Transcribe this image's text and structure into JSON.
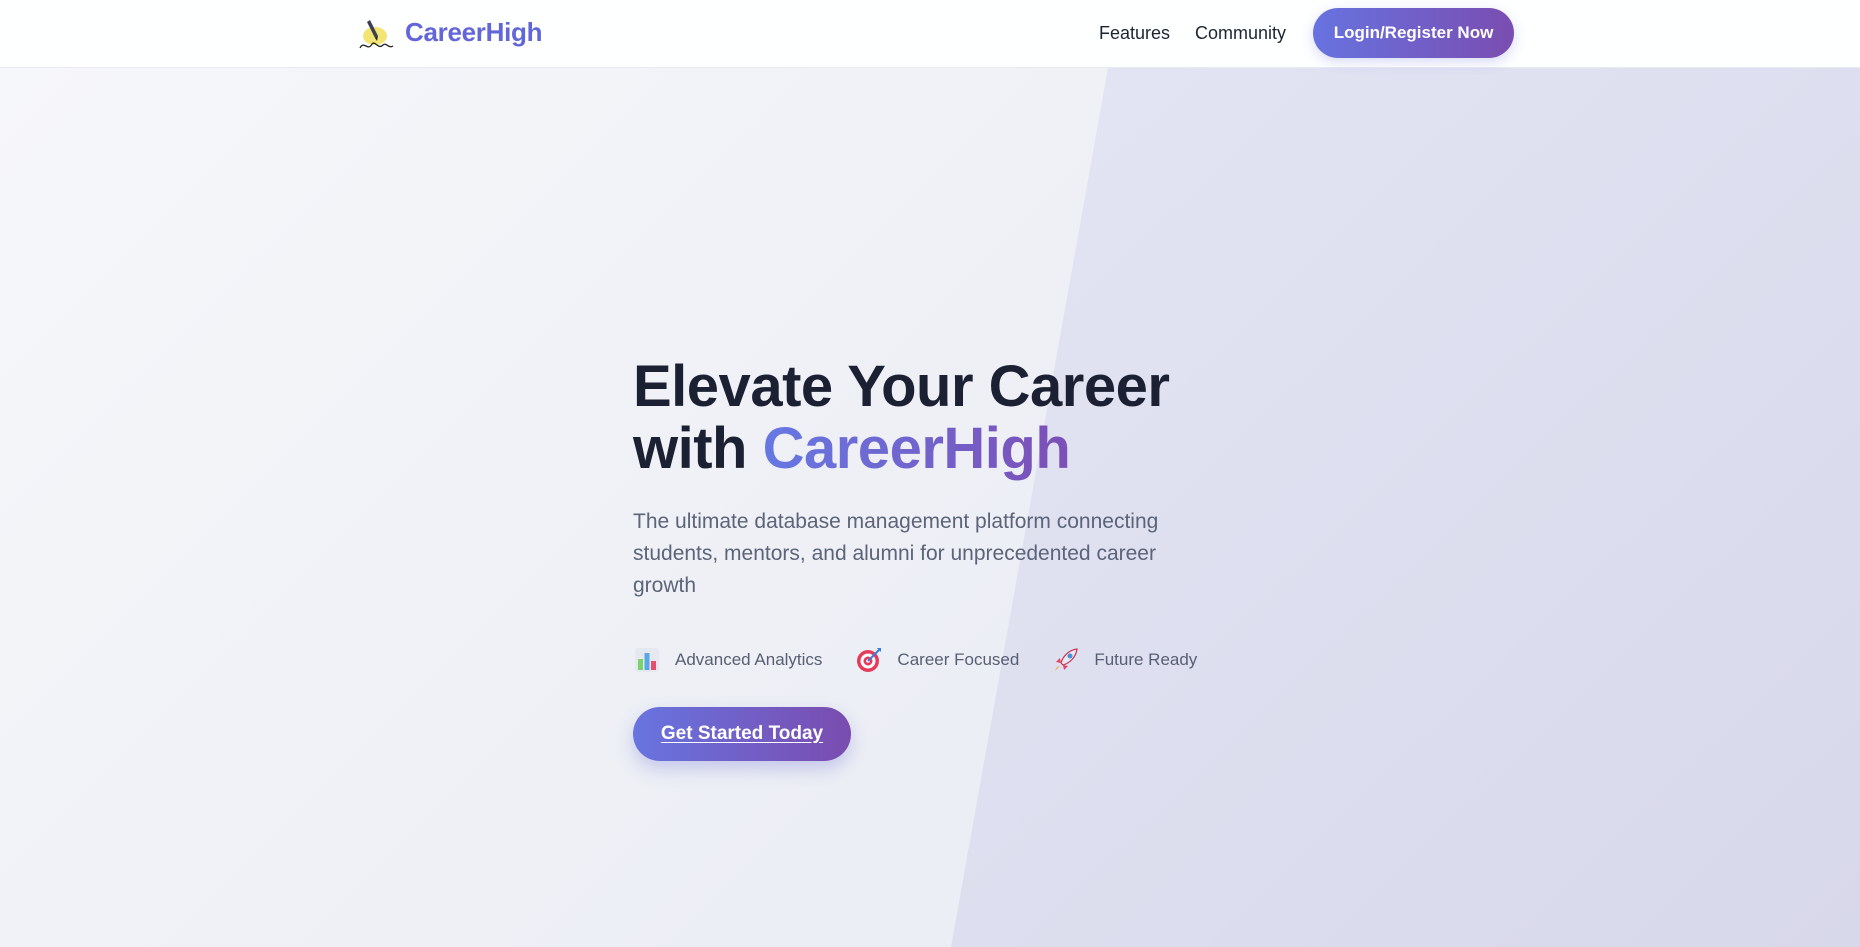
{
  "header": {
    "brand": "CareerHigh",
    "logo_icon": "pen-signature-logo-icon",
    "nav": [
      "Features",
      "Community"
    ],
    "login_label": "Login/Register Now"
  },
  "hero": {
    "headline_line1": "Elevate Your Career",
    "headline_with": "with ",
    "headline_accent": "CareerHigh",
    "subtitle": "The ultimate database management platform connecting students, mentors, and alumni for unprecedented career growth",
    "features": [
      {
        "icon": "bar-chart-icon",
        "label": "Advanced Analytics"
      },
      {
        "icon": "target-icon",
        "label": "Career Focused"
      },
      {
        "icon": "rocket-icon",
        "label": "Future Ready"
      }
    ],
    "cta_label": "Get Started Today"
  },
  "colors": {
    "brand": "#6366d9",
    "gradient_start": "#6678e3",
    "gradient_end": "#7a4caf",
    "heading": "#1b2133",
    "body_text": "#5b6478",
    "hero_shape": "#d9dbee"
  }
}
